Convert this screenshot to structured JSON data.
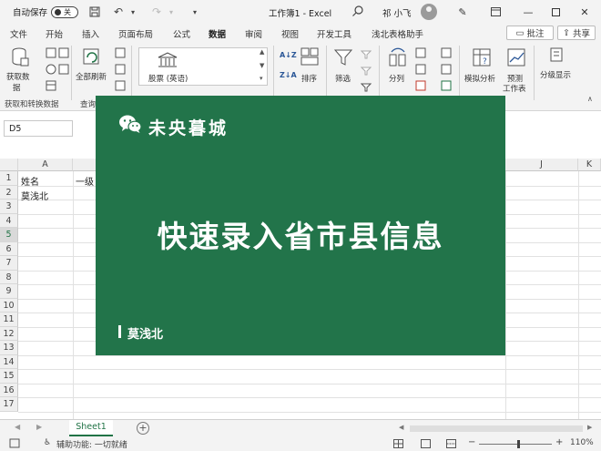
{
  "titlebar": {
    "autosave_label": "自动保存",
    "autosave_state": "关",
    "doc_title": "工作簿1  -  Excel",
    "user_name": "祁 小飞"
  },
  "menu": {
    "tabs": [
      "文件",
      "开始",
      "插入",
      "页面布局",
      "公式",
      "数据",
      "审阅",
      "视图",
      "开发工具",
      "浅北表格助手"
    ],
    "active_tab": "数据",
    "comment_label": "批注",
    "share_label": "共享"
  },
  "ribbon": {
    "get_data": "获取数",
    "get_data2": "据",
    "refresh_all": "全部刷新",
    "stocks_label": "股票 (英语)",
    "sort_label": "排序",
    "filter_label": "筛选",
    "split_label": "分列",
    "whatif_label": "模拟分析",
    "forecast_label": "预测",
    "forecast_label2": "工作表",
    "outline_label": "分级显示",
    "group_get_transform": "获取和转换数据",
    "group_queries": "查询"
  },
  "formula": {
    "namebox": "D5"
  },
  "grid": {
    "columns": [
      "A",
      "J",
      "K"
    ],
    "rows": [
      "1",
      "2",
      "3",
      "4",
      "5",
      "6",
      "7",
      "8",
      "9",
      "10",
      "11",
      "12",
      "13",
      "14",
      "15",
      "16",
      "17"
    ],
    "selected_row": "5",
    "cells": {
      "a1": "姓名",
      "b1": "一级",
      "a2": "莫浅北"
    }
  },
  "sheets": {
    "active": "Sheet1"
  },
  "status": {
    "accessibility": "辅助功能: 一切就绪",
    "zoom": "110%"
  },
  "overlay": {
    "brand": "未央暮城",
    "headline": "快速录入省市县信息",
    "author": "莫浅北",
    "bg_color": "#22744a"
  }
}
